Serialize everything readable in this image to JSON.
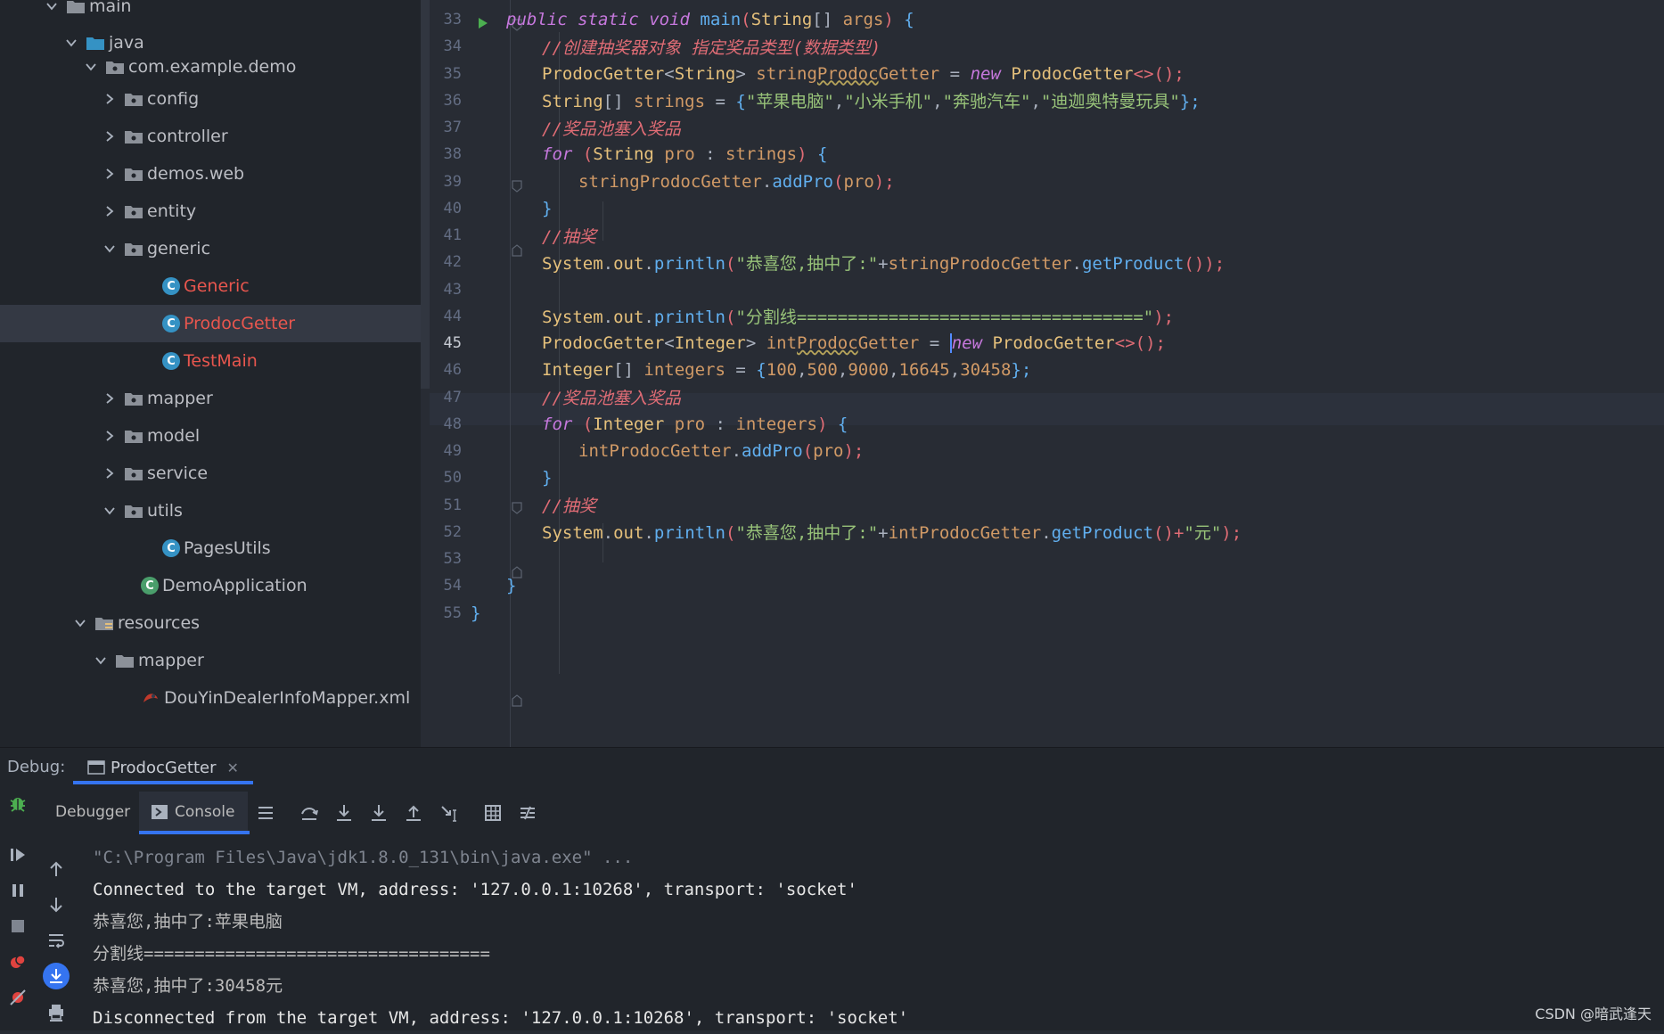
{
  "tree": {
    "items": [
      {
        "label": "main",
        "kind": "folder",
        "expanded": true
      },
      {
        "label": "java",
        "kind": "src-folder",
        "expanded": true
      },
      {
        "label": "com.example.demo",
        "kind": "package",
        "expanded": true
      },
      {
        "label": "config",
        "kind": "package",
        "expanded": false
      },
      {
        "label": "controller",
        "kind": "package",
        "expanded": false
      },
      {
        "label": "demos.web",
        "kind": "package",
        "expanded": false
      },
      {
        "label": "entity",
        "kind": "package",
        "expanded": false
      },
      {
        "label": "generic",
        "kind": "package",
        "expanded": true
      },
      {
        "label": "Generic",
        "kind": "class"
      },
      {
        "label": "ProdocGetter",
        "kind": "class",
        "selected": true
      },
      {
        "label": "TestMain",
        "kind": "class"
      },
      {
        "label": "mapper",
        "kind": "package",
        "expanded": false
      },
      {
        "label": "model",
        "kind": "package",
        "expanded": false
      },
      {
        "label": "service",
        "kind": "package",
        "expanded": false
      },
      {
        "label": "utils",
        "kind": "package",
        "expanded": true
      },
      {
        "label": "PagesUtils",
        "kind": "class"
      },
      {
        "label": "DemoApplication",
        "kind": "spring-class"
      },
      {
        "label": "resources",
        "kind": "res-folder",
        "expanded": true
      },
      {
        "label": "mapper",
        "kind": "folder",
        "expanded": true
      },
      {
        "label": "DouYinDealerInfoMapper.xml",
        "kind": "xml"
      }
    ]
  },
  "editor": {
    "active_line": "45",
    "lines": [
      {
        "n": "33",
        "t": "public static void main(String[] args) {"
      },
      {
        "n": "34",
        "t": "//创建抽奖器对象 指定奖品类型(数据类型)"
      },
      {
        "n": "35",
        "t": "ProdocGetter<String> stringProdocGetter = new ProdocGetter<>();"
      },
      {
        "n": "36",
        "t": "String[] strings = {\"苹果电脑\",\"小米手机\",\"奔驰汽车\",\"迪迦奥特曼玩具\"};"
      },
      {
        "n": "37",
        "t": "//奖品池塞入奖品"
      },
      {
        "n": "38",
        "t": "for (String pro : strings) {"
      },
      {
        "n": "39",
        "t": "stringProdocGetter.addPro(pro);"
      },
      {
        "n": "40",
        "t": "}"
      },
      {
        "n": "41",
        "t": "//抽奖"
      },
      {
        "n": "42",
        "t": "System.out.println(\"恭喜您,抽中了:\"+stringProdocGetter.getProduct());"
      },
      {
        "n": "43",
        "t": ""
      },
      {
        "n": "44",
        "t": "System.out.println(\"分割线==================================\");"
      },
      {
        "n": "45",
        "t": "ProdocGetter<Integer> intProdocGetter = new ProdocGetter<>();"
      },
      {
        "n": "46",
        "t": "Integer[] integers = {100,500,9000,16645,30458};"
      },
      {
        "n": "47",
        "t": "//奖品池塞入奖品"
      },
      {
        "n": "48",
        "t": "for (Integer pro : integers) {"
      },
      {
        "n": "49",
        "t": "intProdocGetter.addPro(pro);"
      },
      {
        "n": "50",
        "t": "}"
      },
      {
        "n": "51",
        "t": "//抽奖"
      },
      {
        "n": "52",
        "t": "System.out.println(\"恭喜您,抽中了:\"+intProdocGetter.getProduct()+\"元\");"
      },
      {
        "n": "53",
        "t": ""
      },
      {
        "n": "54",
        "t": "}"
      },
      {
        "n": "55",
        "t": "}"
      }
    ]
  },
  "debug": {
    "label": "Debug:",
    "session_tab": "ProdocGetter",
    "debugger_tab": "Debugger",
    "console_tab": "Console",
    "console_lines": [
      "\"C:\\Program Files\\Java\\jdk1.8.0_131\\bin\\java.exe\" ...",
      "Connected to the target VM, address: '127.0.0.1:10268', transport: 'socket'",
      "恭喜您,抽中了:苹果电脑",
      "分割线==================================",
      "恭喜您,抽中了:30458元",
      "Disconnected from the target VM, address: '127.0.0.1:10268', transport: 'socket'"
    ]
  },
  "watermark": "CSDN @暗武逢天",
  "colors": {
    "accent": "#3574f0",
    "run_green": "#4caf50",
    "class_icon": "#3592c4",
    "error_red": "#e8564e"
  }
}
